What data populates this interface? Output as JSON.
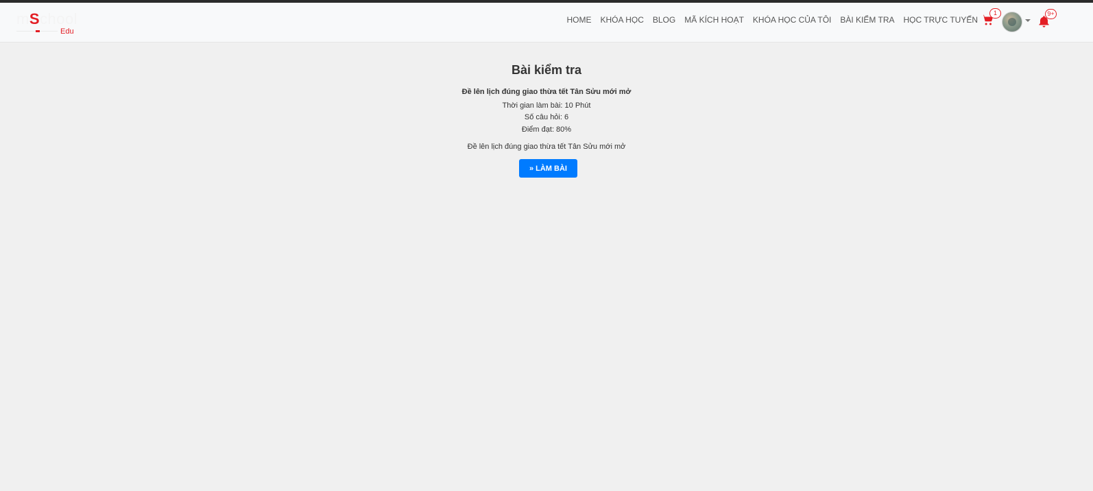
{
  "logo": {
    "text_pre": "m",
    "text_accent": "S",
    "text_post": "chool",
    "sub": "Edu"
  },
  "nav": {
    "items": [
      {
        "label": "HOME"
      },
      {
        "label": "KHÓA HỌC"
      },
      {
        "label": "BLOG"
      },
      {
        "label": "MÃ KÍCH HOẠT"
      },
      {
        "label": "KHÓA HỌC CỦA TÔI"
      },
      {
        "label": "BÀI KIỂM TRA"
      },
      {
        "label": "HỌC TRỰC TUYẾN"
      }
    ],
    "cart_count": "1",
    "notification_count": "9+",
    "icons": {
      "cart": "cart-icon",
      "bell": "bell-icon",
      "caret": "chevron-down-icon"
    }
  },
  "main": {
    "title": "Bài kiểm tra",
    "quiz_name": "Đề lên lịch đúng giao thừa tết Tân Sửu mới mở",
    "time_label": "Thời gian làm bài: 10 Phút",
    "question_count_label": "Số câu hỏi: 6",
    "pass_score_label": "Điểm đạt: 80%",
    "description": "Đề lên lịch đúng giao thừa tết Tân Sửu mới mở",
    "start_button_label": "LÀM BÀI",
    "start_button_icon": "angles-right-icon"
  },
  "colors": {
    "brand_red": "#e31e24",
    "primary_button": "#007bff",
    "navbar_bg": "#f8f9fa",
    "page_bg": "#f0f0f0"
  }
}
